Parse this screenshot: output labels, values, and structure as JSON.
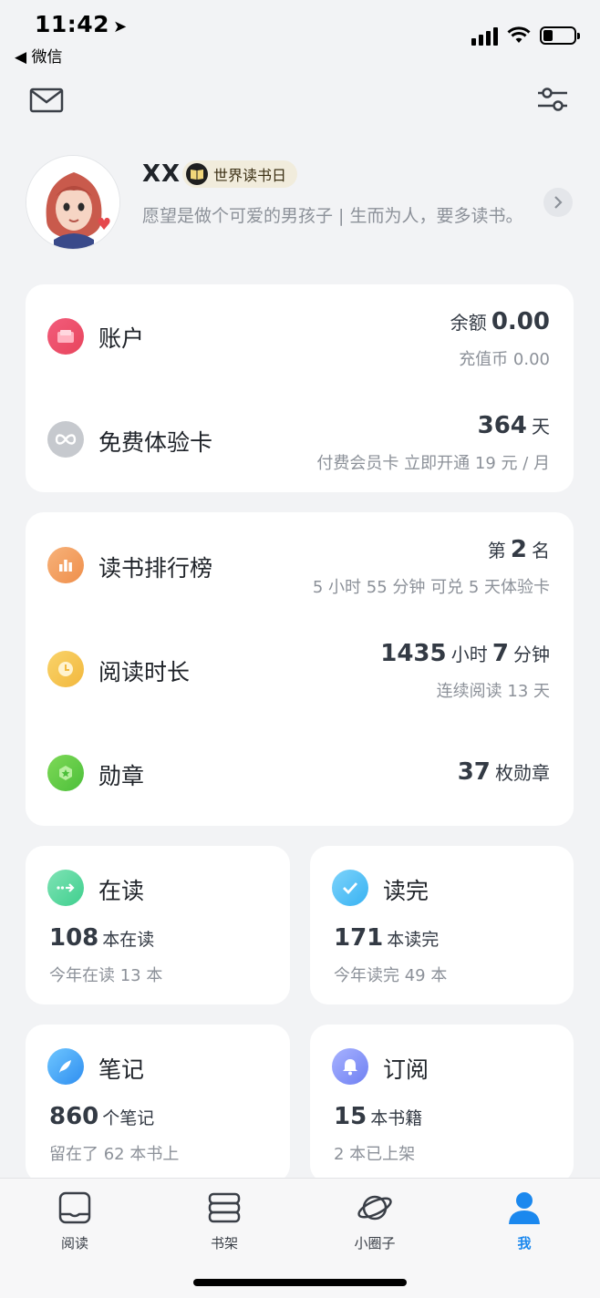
{
  "status": {
    "time": "11:42",
    "back_app": "◀ 微信"
  },
  "profile": {
    "name": "XX",
    "badge": "世界读书日",
    "bio": "愿望是做个可爱的男孩子 | 生而为人，要多读书。"
  },
  "account_card": {
    "account": {
      "title": "账户",
      "balance_label": "余额",
      "balance_value": "0.00",
      "coins_label": "充值币",
      "coins_value": "0.00"
    },
    "trial": {
      "title": "免费体验卡",
      "days": "364",
      "days_unit": "天",
      "sub": "付费会员卡 立即开通 19 元 / 月"
    }
  },
  "reading_card": {
    "rank": {
      "title": "读书排行榜",
      "prefix": "第",
      "value": "2",
      "suffix": "名",
      "sub": "5 小时 55 分钟 可兑 5 天体验卡"
    },
    "duration": {
      "title": "阅读时长",
      "hours": "1435",
      "hours_unit": "小时",
      "minutes": "7",
      "minutes_unit": "分钟",
      "sub": "连续阅读 13 天"
    },
    "medals": {
      "title": "勋章",
      "value": "37",
      "unit": "枚勋章"
    }
  },
  "stats": {
    "reading": {
      "title": "在读",
      "num": "108",
      "unit": "本在读",
      "sub": "今年在读 13 本"
    },
    "finished": {
      "title": "读完",
      "num": "171",
      "unit": "本读完",
      "sub": "今年读完 49 本"
    },
    "notes": {
      "title": "笔记",
      "num": "860",
      "unit": "个笔记",
      "sub": "留在了 62 本书上"
    },
    "subscribe": {
      "title": "订阅",
      "num": "15",
      "unit": "本书籍",
      "sub": "2 本已上架"
    }
  },
  "tabs": [
    {
      "label": "阅读",
      "icon": "book-icon"
    },
    {
      "label": "书架",
      "icon": "bookshelf-icon"
    },
    {
      "label": "小圈子",
      "icon": "planet-icon"
    },
    {
      "label": "我",
      "icon": "person-icon"
    }
  ],
  "colors": {
    "accent": "#1b88ee",
    "background": "#f2f3f5"
  }
}
